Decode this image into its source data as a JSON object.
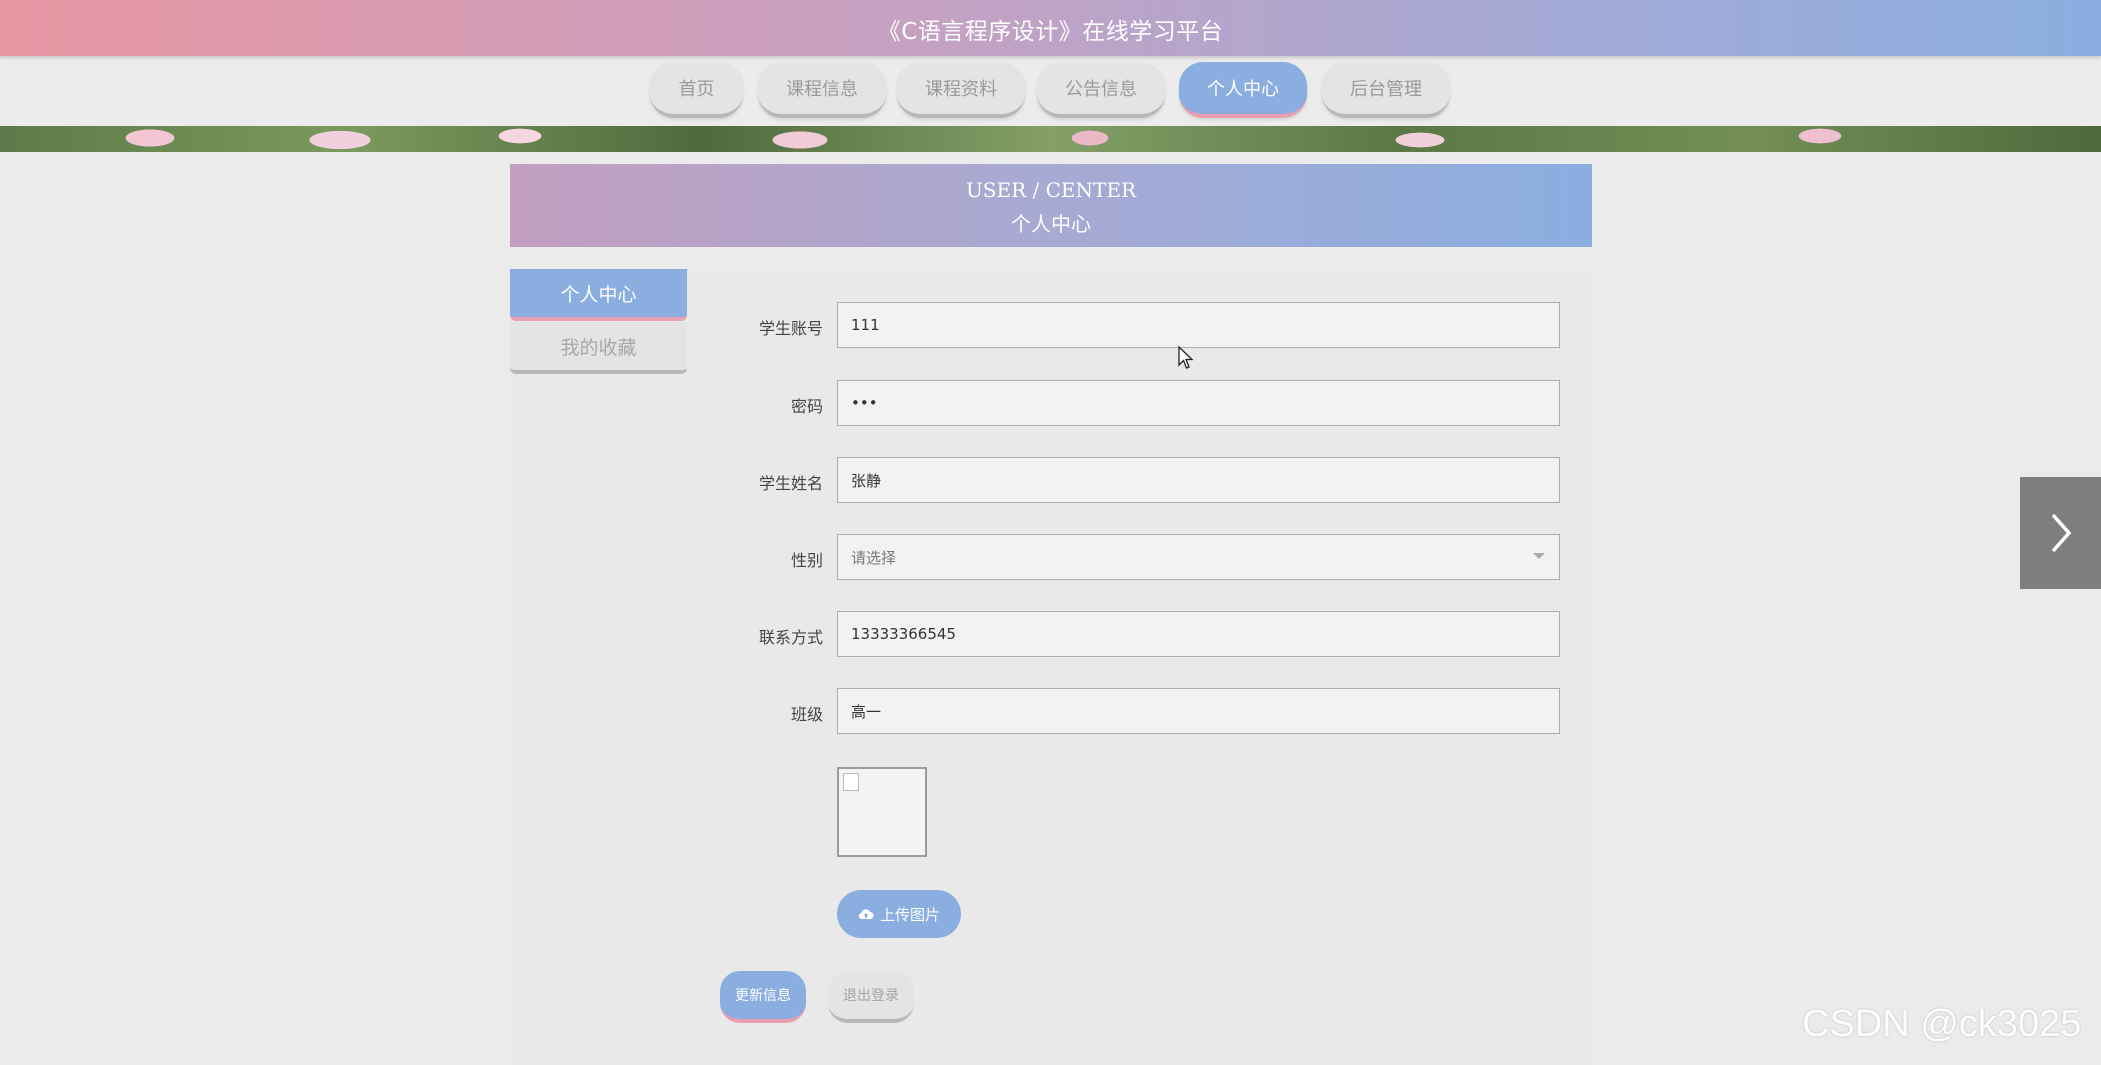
{
  "header": {
    "title": "《C语言程序设计》在线学习平台"
  },
  "nav": {
    "items": [
      {
        "label": "首页"
      },
      {
        "label": "课程信息"
      },
      {
        "label": "课程资料"
      },
      {
        "label": "公告信息"
      },
      {
        "label": "个人中心"
      },
      {
        "label": "后台管理"
      }
    ],
    "active_index": 4
  },
  "user_center": {
    "title_en": "USER / CENTER",
    "title_cn": "个人中心"
  },
  "sidebar": {
    "items": [
      {
        "label": "个人中心",
        "active": true
      },
      {
        "label": "我的收藏",
        "active": false
      }
    ]
  },
  "form": {
    "fields": [
      {
        "label": "学生账号",
        "value": "111"
      },
      {
        "label": "密码",
        "value": "•••"
      },
      {
        "label": "学生姓名",
        "value": "张静"
      },
      {
        "label": "性别",
        "value": "请选择"
      },
      {
        "label": "联系方式",
        "value": "13333366545"
      },
      {
        "label": "班级",
        "value": "高一"
      }
    ],
    "upload_label": "上传图片",
    "update_label": "更新信息",
    "logout_label": "退出登录"
  },
  "icons": {
    "upload": "cloud-upload-icon",
    "next": "chevron-right-icon",
    "select": "caret-down-icon",
    "cursor": "mouse-cursor-icon"
  },
  "colors": {
    "accent": "#8aaee0",
    "pink": "#e8a0b0"
  },
  "watermark": "CSDN @ck3025"
}
